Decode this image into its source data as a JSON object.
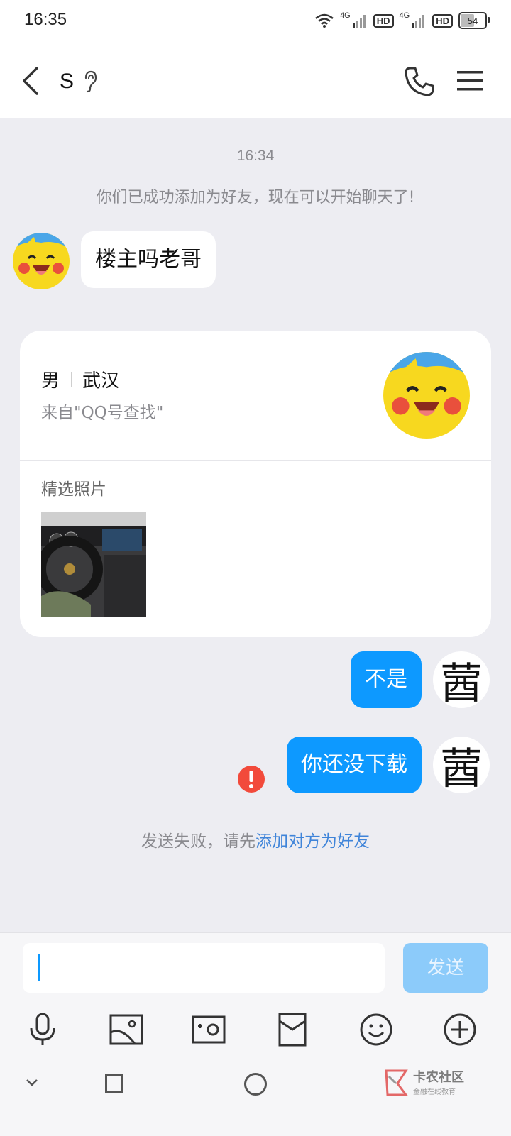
{
  "status_bar": {
    "time": "16:35",
    "network_1": "4G",
    "hd_1": "HD",
    "network_2": "4G",
    "hd_2": "HD",
    "battery": "54",
    "battery_level": 0.54
  },
  "header": {
    "contact_name": "S",
    "icons": [
      "back-arrow-icon",
      "ear-icon",
      "phone-icon",
      "menu-icon"
    ]
  },
  "chat": {
    "timestamp": "16:34",
    "system_message": "你们已成功添加为好友，现在可以开始聊天了!",
    "incoming_message": "楼主吗老哥",
    "profile_card": {
      "gender": "男",
      "city": "武汉",
      "source": "来自\"QQ号查找\"",
      "photos_title": "精选照片"
    },
    "outgoing_messages": [
      "不是",
      "你还没下载"
    ],
    "outgoing_avatar_char": "蒏",
    "send_failed_prefix": "发送失败，请先",
    "send_failed_link": "添加对方为好友"
  },
  "input": {
    "value": "",
    "send_label": "发送",
    "tools": [
      "microphone-icon",
      "image-icon",
      "camera-icon",
      "red-packet-icon",
      "emoji-icon",
      "plus-icon"
    ]
  },
  "watermark": {
    "title": "卡农社区",
    "subtitle": "金融在线教育"
  },
  "colors": {
    "accent": "#0d99ff",
    "send_disabled": "#8ccbfa",
    "error": "#f24a3b",
    "link": "#3f84d9"
  }
}
